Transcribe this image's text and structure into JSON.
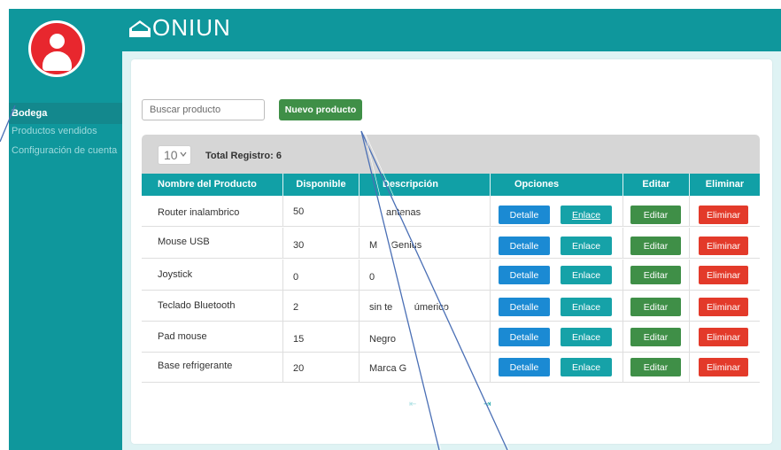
{
  "brand": {
    "name": "ONIUN"
  },
  "sidebar": {
    "items": [
      {
        "label": "Bodega",
        "active": true
      },
      {
        "label": "Productos vendidos",
        "active": false
      },
      {
        "label": "Configuración de cuenta",
        "active": false
      }
    ]
  },
  "toolbar": {
    "search_placeholder": "Buscar producto",
    "new_label": "Nuevo producto"
  },
  "table_controls": {
    "page_size": "10",
    "total_label": "Total Registro: 6"
  },
  "table": {
    "headers": [
      "Nombre del Producto",
      "Disponible",
      "Descripción",
      "Opciones",
      "Editar",
      "Eliminar"
    ],
    "rows": [
      {
        "name": "Router inalambrico",
        "available": "50",
        "description": "antenas",
        "detail": "Detalle",
        "link": "Enlace",
        "edit": "Editar",
        "delete": "Eliminar"
      },
      {
        "name": "Mouse USB",
        "available": "30",
        "description": "M     Genius",
        "detail": "Detalle",
        "link": "Enlace",
        "edit": "Editar",
        "delete": "Eliminar"
      },
      {
        "name": "Joystick",
        "available": "0",
        "description": "0",
        "detail": "Detalle",
        "link": "Enlace",
        "edit": "Editar",
        "delete": "Eliminar"
      },
      {
        "name": "Teclado Bluetooth",
        "available": "2",
        "description": "sin te        úmerico",
        "detail": "Detalle",
        "link": "Enlace",
        "edit": "Editar",
        "delete": "Eliminar"
      },
      {
        "name": "Pad mouse",
        "available": "15",
        "description": "Negro",
        "detail": "Detalle",
        "link": "Enlace",
        "edit": "Editar",
        "delete": "Eliminar"
      },
      {
        "name": "Base refrigerante",
        "available": "20",
        "description": "Marca G",
        "detail": "Detalle",
        "link": "Enlace",
        "edit": "Editar",
        "delete": "Eliminar"
      }
    ]
  },
  "pager": {
    "first": "⇤",
    "last": "⇥"
  },
  "colors": {
    "teal": "#0f979c",
    "header_teal": "#11a0a6",
    "detail_blue": "#1b8ad3",
    "edit_green": "#3f8f47",
    "delete_red": "#e33a2a",
    "avatar_red": "#e8272e"
  }
}
